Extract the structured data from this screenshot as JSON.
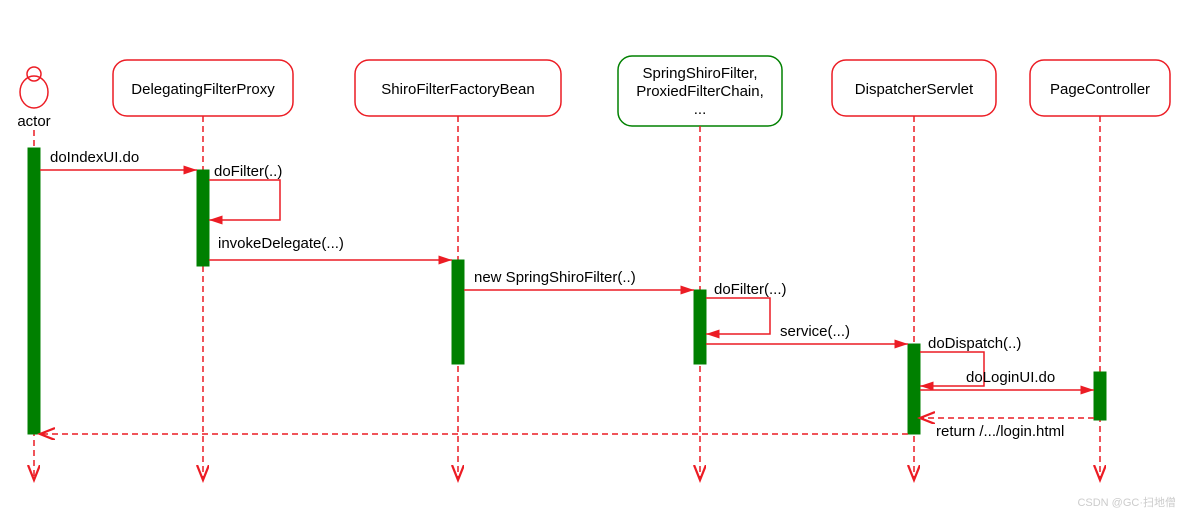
{
  "chart_data": {
    "type": "sequence-diagram",
    "participants": [
      {
        "id": "actor",
        "label": "actor",
        "kind": "actor"
      },
      {
        "id": "p1",
        "label": "DelegatingFilterProxy",
        "kind": "object"
      },
      {
        "id": "p2",
        "label": "ShiroFilterFactoryBean",
        "kind": "object"
      },
      {
        "id": "p3",
        "label": "SpringShiroFilter,\nProxiedFilterChain,\n...",
        "kind": "object",
        "highlight": true
      },
      {
        "id": "p4",
        "label": "DispatcherServlet",
        "kind": "object"
      },
      {
        "id": "p5",
        "label": "PageController",
        "kind": "object"
      }
    ],
    "messages": [
      {
        "from": "actor",
        "to": "p1",
        "label": "doIndexUI.do",
        "type": "sync"
      },
      {
        "from": "p1",
        "to": "p1",
        "label": "doFilter(..)",
        "type": "self"
      },
      {
        "from": "p1",
        "to": "p2",
        "label": "invokeDelegate(...)",
        "type": "sync"
      },
      {
        "from": "p2",
        "to": "p3",
        "label": "new SpringShiroFilter(..)",
        "type": "sync"
      },
      {
        "from": "p3",
        "to": "p3",
        "label": "doFilter(...)",
        "type": "self"
      },
      {
        "from": "p3",
        "to": "p4",
        "label": "service(...)",
        "type": "sync"
      },
      {
        "from": "p4",
        "to": "p4",
        "label": "doDispatch(..)",
        "type": "self"
      },
      {
        "from": "p4",
        "to": "p5",
        "label": "doLoginUI.do",
        "type": "sync"
      },
      {
        "from": "p5",
        "to": "p4",
        "label": "return /.../login.html",
        "type": "return"
      },
      {
        "from": "p4",
        "to": "actor",
        "label": "",
        "type": "return"
      }
    ]
  },
  "watermark": "CSDN @GC·扫地僧"
}
